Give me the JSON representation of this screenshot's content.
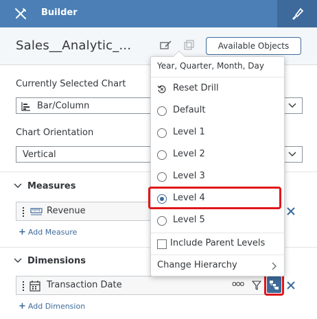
{
  "topbar": {
    "title": "Builder",
    "left_icon": "tools-icon",
    "right_icon": "paint-brush-icon",
    "accent": "#4b7fb5"
  },
  "header": {
    "story_name": "Sales__Analytic_...",
    "available_objects_label": "Available Objects",
    "icons": [
      "edit-icon",
      "copy-icon"
    ]
  },
  "builder": {
    "selected_chart_label": "Currently Selected Chart",
    "selected_chart_value": "Bar/Column",
    "orientation_label": "Chart Orientation",
    "orientation_value": "Vertical"
  },
  "measures": {
    "title": "Measures",
    "items": [
      {
        "label": "Revenue",
        "icon": "measure-icon"
      }
    ],
    "add_label": "Add Measure"
  },
  "dimensions": {
    "title": "Dimensions",
    "items": [
      {
        "label": "Transaction Date",
        "icon": "calendar-icon",
        "more_label": "ooo"
      }
    ],
    "add_label": "Add Dimension"
  },
  "drill_popup": {
    "header": "Year, Quarter, Month, Day",
    "reset_label": "Reset Drill",
    "levels": [
      {
        "label": "Default",
        "selected": false
      },
      {
        "label": "Level 1",
        "selected": false
      },
      {
        "label": "Level 2",
        "selected": false
      },
      {
        "label": "Level 3",
        "selected": false
      },
      {
        "label": "Level 4",
        "selected": true
      },
      {
        "label": "Level 5",
        "selected": false
      }
    ],
    "include_parent_label": "Include Parent Levels",
    "include_parent_checked": false,
    "change_hierarchy_label": "Change Hierarchy"
  },
  "highlight_color": "#e0161b"
}
